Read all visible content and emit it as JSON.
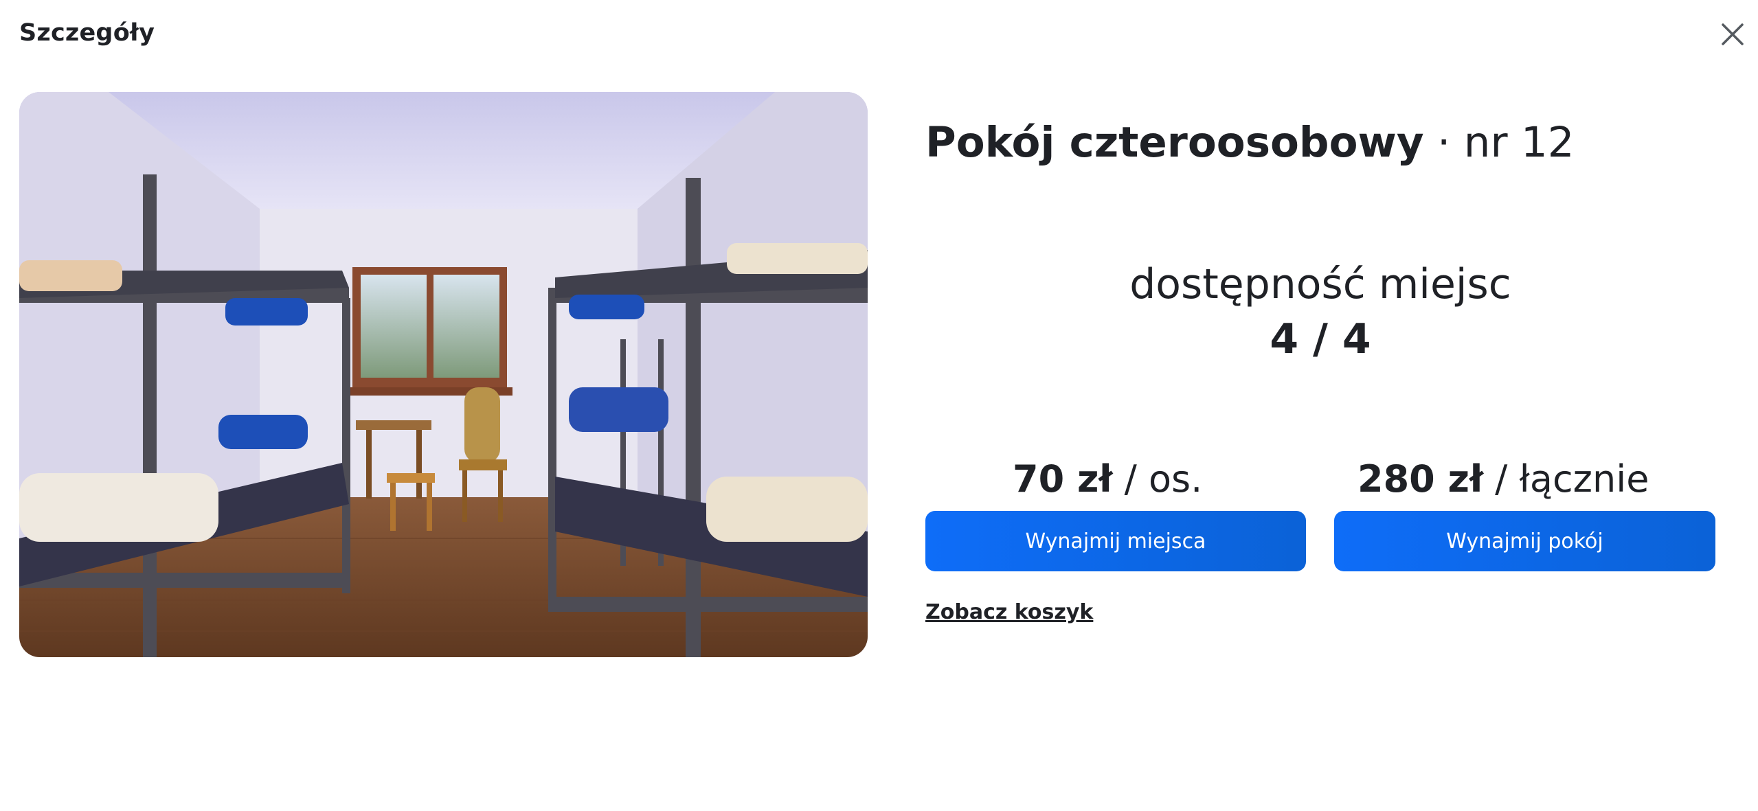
{
  "modal": {
    "title": "Szczegóły",
    "close_icon": "close-icon"
  },
  "photo": {
    "subject": "room-photo"
  },
  "room": {
    "name": "Pokój czteroosobowy",
    "separator": " · ",
    "number": "nr 12"
  },
  "availability": {
    "label": "dostępność miejsc",
    "value": "4 / 4"
  },
  "prices": {
    "per_person": {
      "amount": "70 zł",
      "unit": " / os."
    },
    "total": {
      "amount": "280 zł",
      "unit": " / łącznie"
    }
  },
  "actions": {
    "rent_seats": "Wynajmij miejsca",
    "rent_room": "Wynajmij pokój",
    "view_cart": "Zobacz koszyk"
  },
  "colors": {
    "accent": "#0e6df8",
    "text": "#1f2126"
  }
}
